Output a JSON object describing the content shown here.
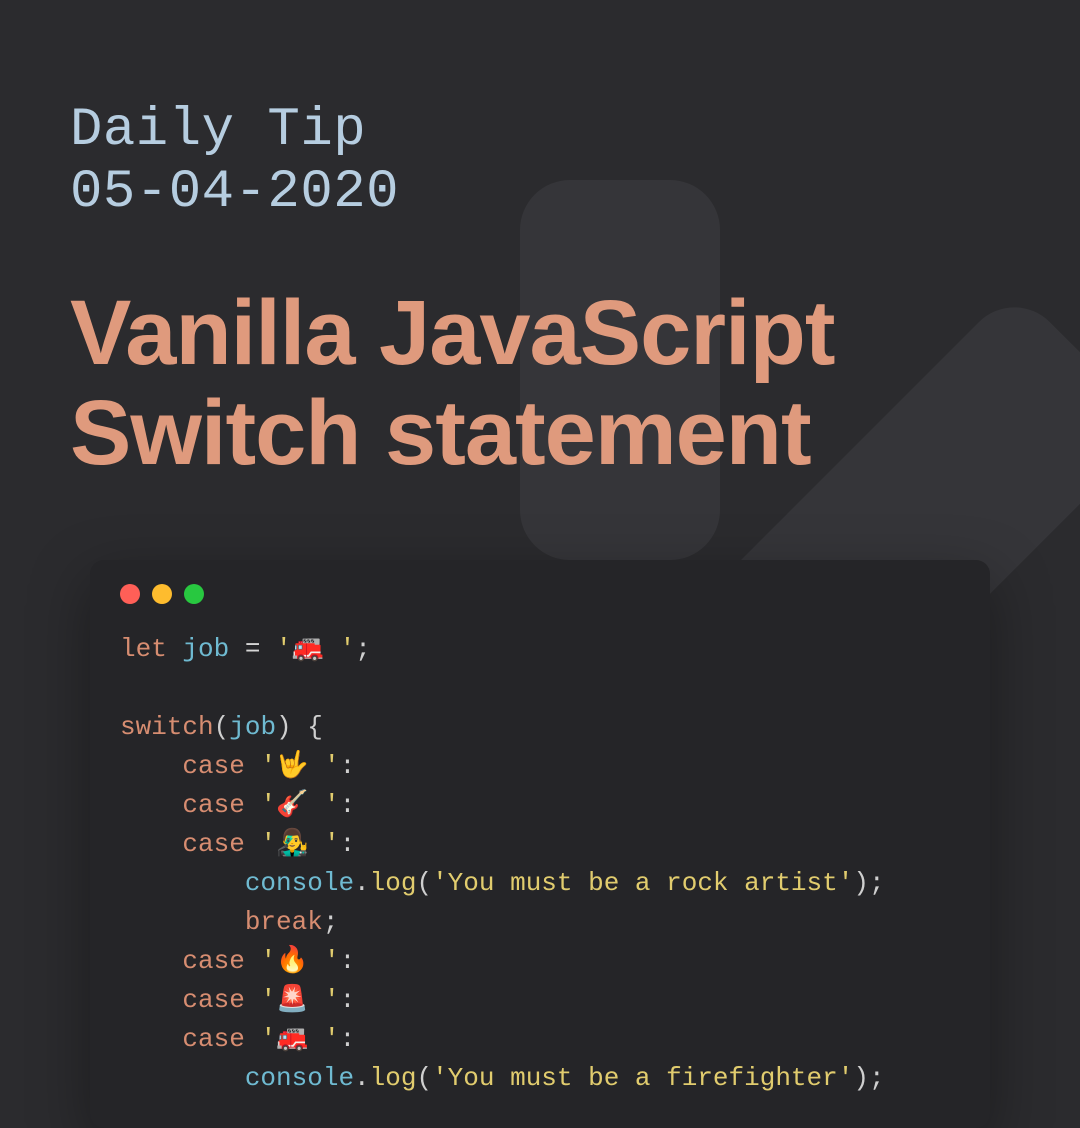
{
  "eyebrow_line1": "Daily Tip",
  "eyebrow_line2": "05-04-2020",
  "title_line1": "Vanilla JavaScript",
  "title_line2": "Switch statement",
  "code": {
    "let": "let",
    "job_ident": "job",
    "eq": " = ",
    "job_val": "'🚒 '",
    "semi": ";",
    "switch": "switch",
    "lpar": "(",
    "rpar": ")",
    "lbrace": " {",
    "case": "case",
    "c1": "'🤟 '",
    "c2": "'🎸 '",
    "c3": "'👨‍🎤 '",
    "colon": ":",
    "console": "console",
    "dot": ".",
    "log": "log",
    "msg1": "'You must be a rock artist'",
    "break": "break",
    "c4": "'🔥 '",
    "c5": "'🚨 '",
    "c6": "'🚒 '",
    "msg2": "'You must be a firefighter'"
  }
}
